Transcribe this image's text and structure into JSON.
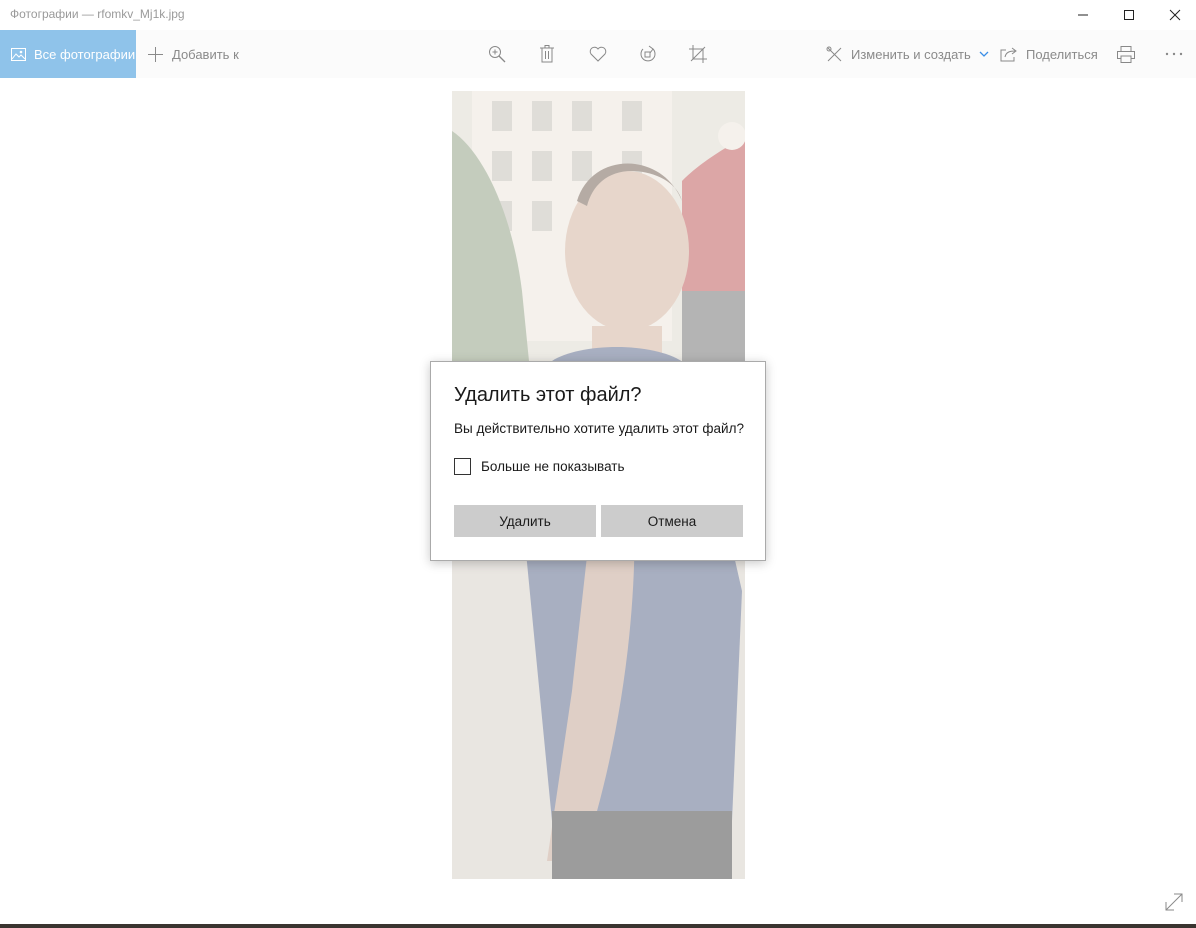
{
  "window": {
    "title": "Фотографии — rfomkv_Mj1k.jpg",
    "buttons": [
      "minimize",
      "maximize",
      "close"
    ]
  },
  "toolbar": {
    "all_photos_label": "Все фотографии",
    "add_to_label": "Добавить к",
    "edit_create_label": "Изменить и создать",
    "share_label": "Поделиться",
    "icons": [
      "zoom-icon",
      "delete-icon",
      "favorite-icon",
      "rotate-icon",
      "crop-icon",
      "print-icon",
      "more-icon"
    ],
    "accent": "#8fc3ea"
  },
  "dialog": {
    "title": "Удалить этот файл?",
    "message": "Вы действительно хотите удалить этот файл?",
    "checkbox_label": "Больше не показывать",
    "checkbox_checked": false,
    "delete_label": "Удалить",
    "cancel_label": "Отмена"
  }
}
